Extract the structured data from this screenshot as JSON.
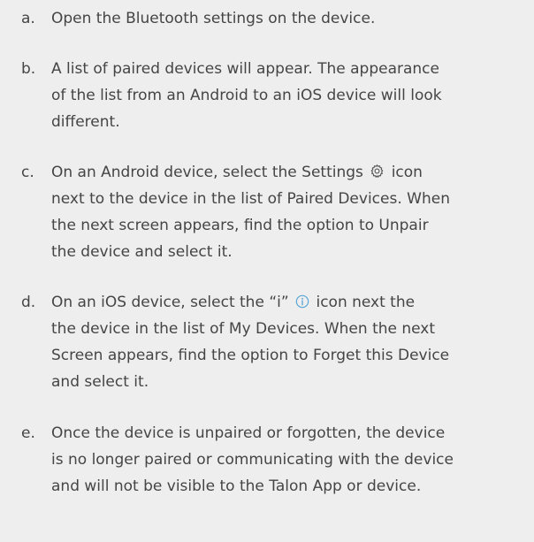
{
  "steps": [
    {
      "marker": "a.",
      "text": "Open the Bluetooth settings on the device."
    },
    {
      "marker": "b.",
      "lines": [
        "A list of paired devices will appear. The appearance",
        "of the list from an Android to an iOS device will look",
        "different."
      ]
    },
    {
      "marker": "c.",
      "line1_before_icon": "On an Android device, select the Settings",
      "line1_after_icon": "icon",
      "icon": "gear-icon",
      "lines_rest": [
        "next to the device in the list of Paired Devices. When",
        "the next screen appears, find the option to Unpair",
        "the device and select it."
      ]
    },
    {
      "marker": "d.",
      "line1_before_icon": "On an iOS device, select the “i”",
      "line1_after_icon": "icon next the",
      "icon": "info-icon",
      "lines_rest": [
        "the device in the list of My Devices. When the next",
        "Screen appears, find the option to Forget this Device",
        "and select it."
      ]
    },
    {
      "marker": "e.",
      "lines": [
        "Once the device is unpaired or forgotten, the device",
        "is no longer paired or communicating with the device",
        "and will not be visible to the Talon App or device."
      ]
    }
  ],
  "colors": {
    "background": "#eeeeee",
    "text": "#454545",
    "info_icon": "#5aa7d6"
  }
}
